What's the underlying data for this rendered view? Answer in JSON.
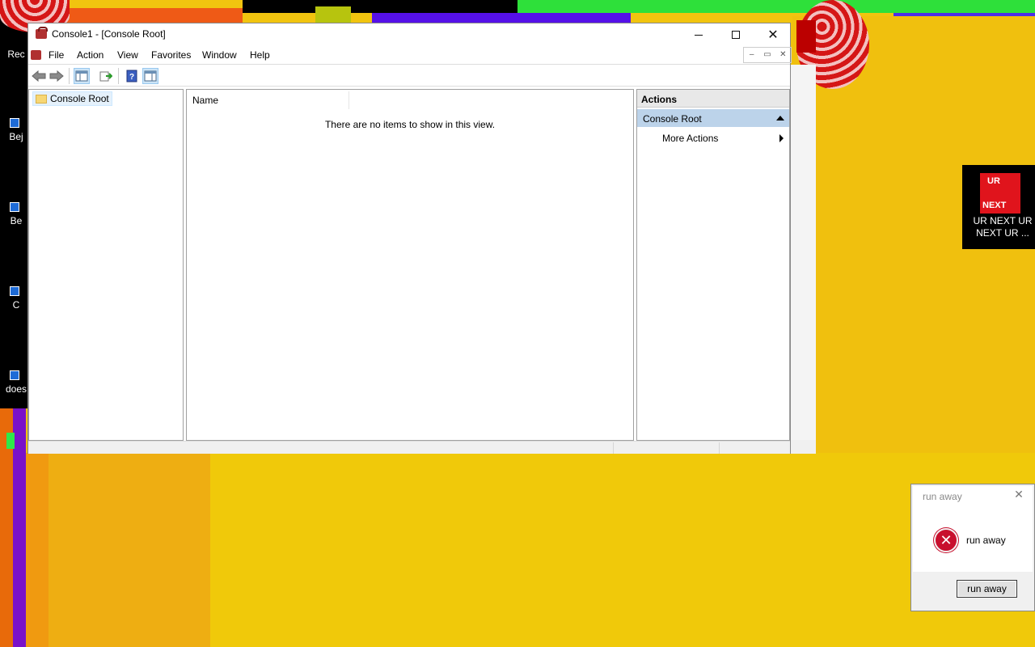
{
  "window": {
    "title": "Console1 - [Console Root]",
    "caption": {
      "minimize": "—",
      "maximize": "☐",
      "close": "✕"
    }
  },
  "menu": {
    "items": [
      "File",
      "Action",
      "View",
      "Favorites",
      "Window",
      "Help"
    ]
  },
  "mdi_controls": {
    "minimize": "–",
    "restore": "▭",
    "close": "✕"
  },
  "tree": {
    "root_label": "Console Root"
  },
  "list": {
    "column_name": "Name",
    "empty_message": "There are no items to show in this view."
  },
  "actions": {
    "title": "Actions",
    "section": "Console Root",
    "item": "More Actions"
  },
  "desktop": {
    "icons": [
      "Rec",
      "Bej",
      "Be",
      "C",
      "does"
    ],
    "ur_popup": {
      "red_top": "UR",
      "red_bottom": "NEXT",
      "text": "UR NEXT UR NEXT UR ..."
    }
  },
  "dialog": {
    "title": "run away",
    "message": "run away",
    "button": "run away",
    "close": "✕"
  },
  "colors": {
    "accent_selection": "#bcd3ea",
    "desktop_yellow": "#f1c40f",
    "error_red": "#c8102e"
  },
  "icons": [
    "back-arrow-icon",
    "forward-arrow-icon",
    "show-hide-tree-icon",
    "export-list-icon",
    "help-icon",
    "show-hide-action-pane-icon",
    "folder-icon",
    "error-icon"
  ]
}
